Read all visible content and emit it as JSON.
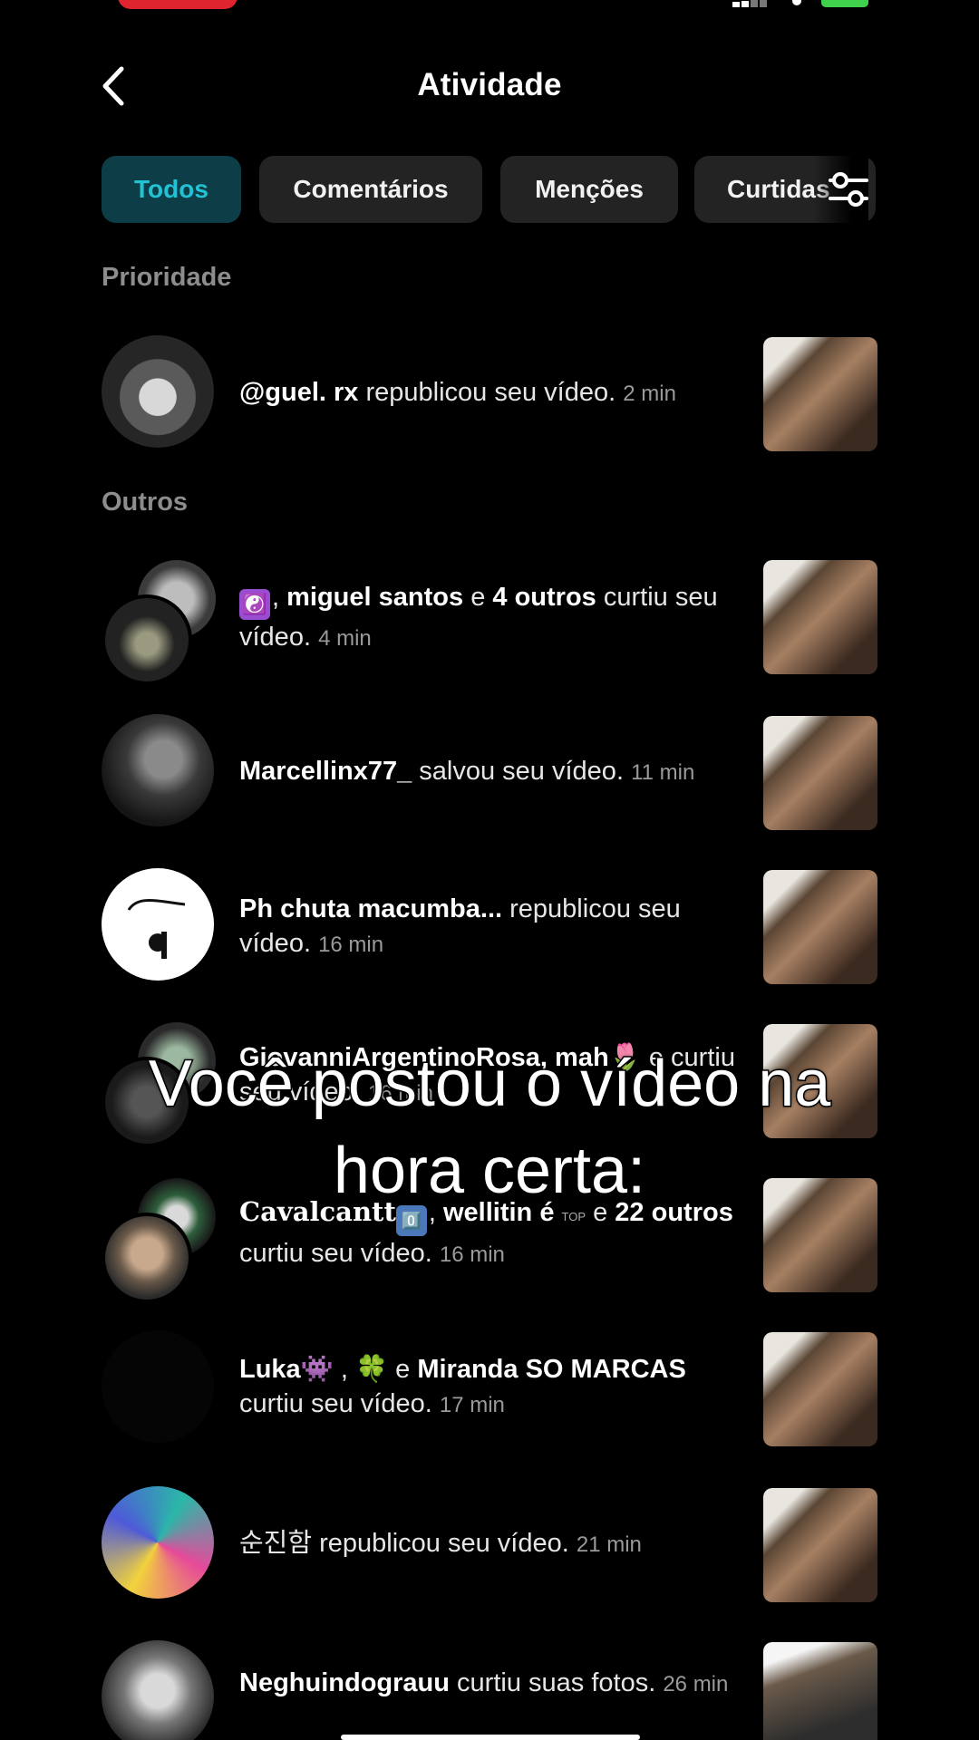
{
  "header": {
    "title": "Atividade"
  },
  "tabs": [
    {
      "label": "Todos",
      "active": true
    },
    {
      "label": "Comentários",
      "active": false
    },
    {
      "label": "Menções",
      "active": false
    },
    {
      "label": "Curtidas",
      "active": false
    }
  ],
  "sections": {
    "priority": "Prioridade",
    "others": "Outros"
  },
  "notifications": [
    {
      "user": "@guel. rx",
      "action": "republicou seu vídeo.",
      "time": "2 min"
    },
    {
      "user_main": "miguel santos",
      "joiner": "e",
      "others": "4 outros",
      "action": "curtiu seu vídeo.",
      "time": "4 min",
      "emoji": "☯️"
    },
    {
      "user": "Marcellinx77_",
      "action": "salvou seu vídeo.",
      "time": "11 min"
    },
    {
      "user": "Ph chuta macumba...",
      "action": "republicou seu vídeo.",
      "time": "16 min"
    },
    {
      "user": "GiovanniArgentinoRosa, mah",
      "emoji": "🌷",
      "joiner": "e",
      "action": "curtiu seu vídeo.",
      "time": "16 min"
    },
    {
      "user_main": "Cavalcantt",
      "emoji": "0️⃣",
      "user_second": "wellitin é",
      "joiner": "e",
      "others": "22 outros",
      "action": "curtiu seu vídeo.",
      "time": "16 min",
      "badge": "TOP"
    },
    {
      "user_main": "Luka",
      "emoji": "👾",
      "emoji2": "🍀",
      "joiner": "e",
      "user_second": "Miranda SO MARCAS",
      "action": "curtiu seu vídeo.",
      "time": "17 min"
    },
    {
      "user": "순진함",
      "action": "republicou seu vídeo.",
      "time": "21 min"
    },
    {
      "user": "Neghuindograuu",
      "action": "curtiu suas fotos.",
      "time": "26 min"
    }
  ],
  "overlay_caption": {
    "line1": "Você postou o vídeo na",
    "line2": "hora certa:"
  },
  "colors": {
    "background": "#000000",
    "tab_active_bg": "#0d3e47",
    "tab_active_text": "#22c2d4",
    "tab_bg": "#232323",
    "muted": "#8d8d8d"
  }
}
